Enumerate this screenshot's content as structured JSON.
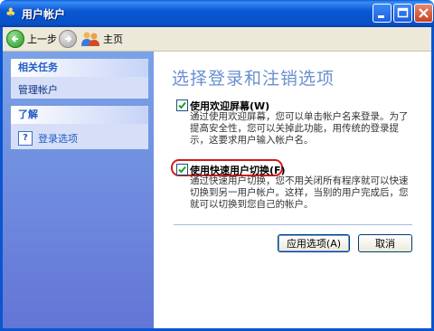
{
  "window": {
    "title": "用户帐户"
  },
  "toolbar": {
    "back_label": "上一步",
    "home_label": "主页"
  },
  "sidebar": {
    "tasks_header": "相关任务",
    "tasks_link": "管理帐户",
    "learn_header": "了解",
    "learn_link": "登录选项"
  },
  "main": {
    "heading": "选择登录和注销选项",
    "options": [
      {
        "label": "使用欢迎屏幕(W)",
        "checked": true,
        "description": "通过使用欢迎屏幕，您可以单击帐户名来登录。为了提高安全性，您可以关掉此功能，用传统的登录提示，这要求用户输入帐户名。"
      },
      {
        "label": "使用快速用户切换(F)",
        "checked": true,
        "description": "通过快速用户切换，您不用关闭所有程序就可以快速切换到另一用户帐户。这样，当别的用户完成后，您就可以切换到您自己的帐户。"
      }
    ],
    "apply_button": "应用选项(A)",
    "cancel_button": "取消"
  },
  "colors": {
    "titlebar": "#0a58d3",
    "sidebar": "#6f8fdd",
    "heading": "#6b8fcf",
    "highlight": "#d21b1b"
  }
}
